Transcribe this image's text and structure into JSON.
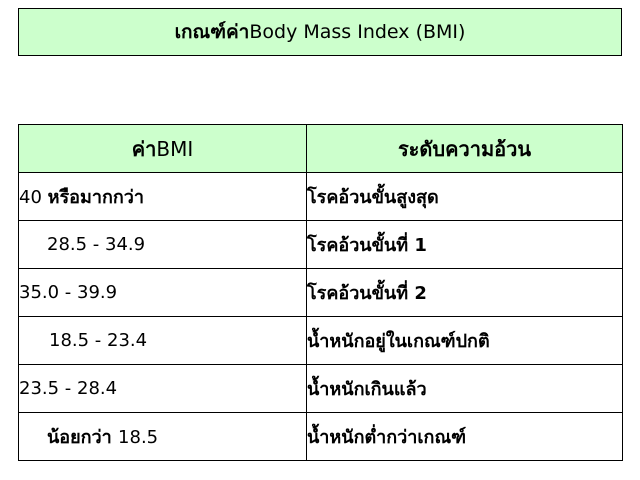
{
  "title": {
    "thai": "เกณฑ์ค่า",
    "english": "Body Mass Index (BMI)"
  },
  "table": {
    "header_col1_thai": "ค่า",
    "header_col1_latin": "BMI",
    "header_col2": "ระดับความอ้วน",
    "rows": [
      {
        "range_num": "40 ",
        "range_thai": "หรือมากกว่า",
        "level": "โรคอ้วนขั้นสูงสุด"
      },
      {
        "range_num": "28.5 - 34.9",
        "level": "โรคอ้วนขั้นที่ 1"
      },
      {
        "range_num": "35.0 - 39.9",
        "level": "โรคอ้วนขั้นที่ 2"
      },
      {
        "range_num": "18.5 - 23.4",
        "level": "น้ำหนักอยู่ในเกณฑ์ปกติ"
      },
      {
        "range_num": "23.5 - 28.4",
        "level": "น้ำหนักเกินแล้ว"
      },
      {
        "range_thai": "น้อยกว่า ",
        "range_num": "18.5",
        "level": "น้ำหนักต่ำกว่าเกณฑ์"
      }
    ]
  }
}
